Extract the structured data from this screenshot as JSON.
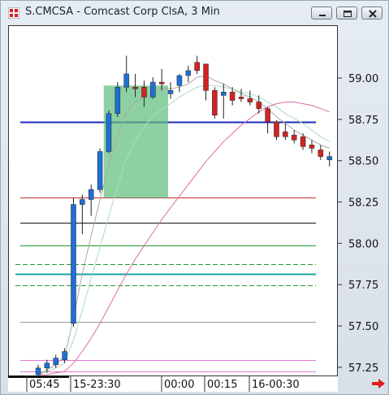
{
  "window": {
    "title": "S.CMCSA - Comcast Corp ClsA, 3 Min",
    "icons": [
      "app-icon",
      "minimize-icon",
      "restore-icon",
      "close-icon"
    ]
  },
  "chart_data": {
    "type": "candlestick",
    "y_ticks": [
      "59.00",
      "58.75",
      "58.50",
      "58.25",
      "58.00",
      "57.75",
      "57.50",
      "57.25"
    ],
    "x_ticks": [
      "05:45",
      "15-23:30",
      "00:00",
      "00:15",
      "16-00:30"
    ],
    "ylim": [
      57.2,
      59.32
    ],
    "candles": [
      {
        "o": 57.21,
        "h": 57.27,
        "l": 57.19,
        "c": 57.25
      },
      {
        "o": 57.25,
        "h": 57.3,
        "l": 57.22,
        "c": 57.28
      },
      {
        "o": 57.27,
        "h": 57.33,
        "l": 57.25,
        "c": 57.31
      },
      {
        "o": 57.3,
        "h": 57.37,
        "l": 57.28,
        "c": 57.35
      },
      {
        "o": 57.52,
        "h": 58.28,
        "l": 57.5,
        "c": 58.24
      },
      {
        "o": 58.24,
        "h": 58.3,
        "l": 58.06,
        "c": 58.27
      },
      {
        "o": 58.27,
        "h": 58.36,
        "l": 58.17,
        "c": 58.33
      },
      {
        "o": 58.33,
        "h": 58.58,
        "l": 58.31,
        "c": 58.56
      },
      {
        "o": 58.56,
        "h": 58.81,
        "l": 58.55,
        "c": 58.79
      },
      {
        "o": 58.79,
        "h": 58.98,
        "l": 58.77,
        "c": 58.95
      },
      {
        "o": 58.95,
        "h": 59.14,
        "l": 58.92,
        "c": 59.03
      },
      {
        "o": 58.95,
        "h": 59.03,
        "l": 58.89,
        "c": 58.94
      },
      {
        "o": 58.95,
        "h": 58.99,
        "l": 58.83,
        "c": 58.89
      },
      {
        "o": 58.89,
        "h": 59.01,
        "l": 58.88,
        "c": 58.98
      },
      {
        "o": 58.98,
        "h": 59.06,
        "l": 58.93,
        "c": 58.97
      },
      {
        "o": 58.91,
        "h": 58.98,
        "l": 58.88,
        "c": 58.93
      },
      {
        "o": 58.96,
        "h": 59.03,
        "l": 58.92,
        "c": 59.02
      },
      {
        "o": 59.02,
        "h": 59.08,
        "l": 58.98,
        "c": 59.05
      },
      {
        "o": 59.1,
        "h": 59.14,
        "l": 59.03,
        "c": 59.05
      },
      {
        "o": 59.09,
        "h": 59.09,
        "l": 58.87,
        "c": 58.93
      },
      {
        "o": 58.93,
        "h": 58.95,
        "l": 58.76,
        "c": 58.78
      },
      {
        "o": 58.9,
        "h": 58.97,
        "l": 58.76,
        "c": 58.92
      },
      {
        "o": 58.92,
        "h": 58.95,
        "l": 58.84,
        "c": 58.87
      },
      {
        "o": 58.89,
        "h": 58.94,
        "l": 58.86,
        "c": 58.88
      },
      {
        "o": 58.88,
        "h": 58.93,
        "l": 58.84,
        "c": 58.86
      },
      {
        "o": 58.86,
        "h": 58.9,
        "l": 58.79,
        "c": 58.82
      },
      {
        "o": 58.82,
        "h": 58.83,
        "l": 58.67,
        "c": 58.74
      },
      {
        "o": 58.74,
        "h": 58.75,
        "l": 58.63,
        "c": 58.65
      },
      {
        "o": 58.68,
        "h": 58.73,
        "l": 58.63,
        "c": 58.65
      },
      {
        "o": 58.66,
        "h": 58.69,
        "l": 58.61,
        "c": 58.63
      },
      {
        "o": 58.65,
        "h": 58.67,
        "l": 58.57,
        "c": 58.59
      },
      {
        "o": 58.6,
        "h": 58.63,
        "l": 58.55,
        "c": 58.58
      },
      {
        "o": 58.57,
        "h": 58.6,
        "l": 58.51,
        "c": 58.53
      },
      {
        "o": 58.51,
        "h": 58.56,
        "l": 58.47,
        "c": 58.53
      }
    ],
    "highlight_box": {
      "from_index": 7.7,
      "to_index": 15,
      "top": 58.96,
      "bottom": 58.28,
      "color": "#5dbd7a"
    },
    "horizontal_lines": [
      {
        "value": 58.74,
        "color": "#1d2bb8",
        "kind": "solid",
        "width": 2
      },
      {
        "value": 58.28,
        "color": "#c42e2e",
        "kind": "solid",
        "width": 1
      },
      {
        "value": 58.13,
        "color": "#111111",
        "kind": "solid",
        "width": 1
      },
      {
        "value": 57.99,
        "color": "#1f9a2a",
        "kind": "solid",
        "width": 1
      },
      {
        "value": 57.88,
        "color": "#1f9a2a",
        "kind": "dashed",
        "width": 1
      },
      {
        "value": 57.82,
        "color": "#17a6a0",
        "kind": "solid",
        "width": 2
      },
      {
        "value": 57.75,
        "color": "#1f9a2a",
        "kind": "dashed",
        "width": 1
      },
      {
        "value": 57.53,
        "color": "#999999",
        "kind": "solid",
        "width": 1
      },
      {
        "value": 57.3,
        "color": "#e07ad8",
        "kind": "solid",
        "width": 1
      },
      {
        "value": 57.23,
        "color": "#e07ad8",
        "kind": "solid",
        "width": 1
      }
    ],
    "moving_averages": [
      {
        "color": "#a8a8a8",
        "values": [
          57.21,
          57.24,
          57.27,
          57.32,
          57.55,
          57.82,
          58.05,
          58.27,
          58.48,
          58.66,
          58.8,
          58.86,
          58.89,
          58.92,
          58.94,
          58.94,
          58.95,
          58.97,
          59.01,
          59.02,
          58.99,
          58.97,
          58.94,
          58.91,
          58.89,
          58.86,
          58.82,
          58.77,
          58.73,
          58.69,
          58.66,
          58.63,
          58.6,
          58.58
        ]
      },
      {
        "color": "#a8dcc0",
        "values": [
          57.21,
          57.23,
          57.25,
          57.28,
          57.42,
          57.6,
          57.79,
          57.98,
          58.17,
          58.35,
          58.52,
          58.63,
          58.71,
          58.77,
          58.82,
          58.85,
          58.89,
          58.92,
          58.95,
          58.96,
          58.96,
          58.95,
          58.94,
          58.92,
          58.91,
          58.89,
          58.86,
          58.83,
          58.79,
          58.76,
          58.73,
          58.69,
          58.65,
          58.62
        ]
      },
      {
        "color": "#e06aa8",
        "values": [
          57.21,
          57.21,
          57.22,
          57.23,
          57.28,
          57.35,
          57.43,
          57.52,
          57.62,
          57.72,
          57.82,
          57.91,
          57.99,
          58.07,
          58.15,
          58.22,
          58.29,
          58.36,
          58.43,
          58.5,
          58.56,
          58.62,
          58.67,
          58.72,
          58.76,
          58.8,
          58.83,
          58.85,
          58.86,
          58.86,
          58.85,
          58.84,
          58.82,
          58.8
        ]
      }
    ],
    "colors": {
      "up": "#1f6fd6",
      "down": "#d42222",
      "doji": "#6b4b2a"
    }
  }
}
